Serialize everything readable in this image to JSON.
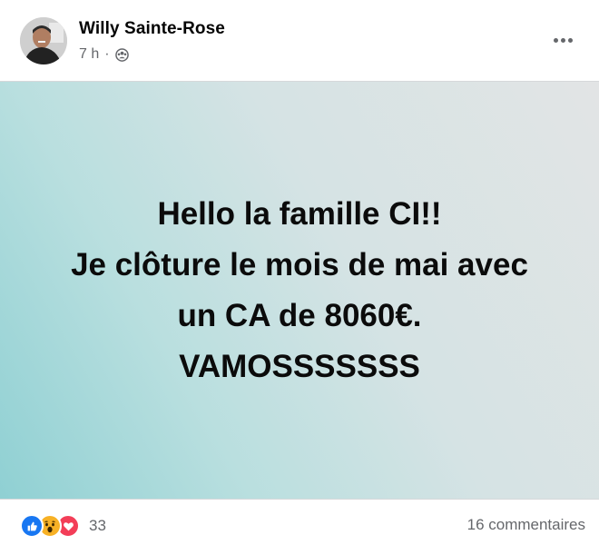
{
  "post": {
    "author": "Willy Sainte-Rose",
    "time": "7 h",
    "separator": "·",
    "audience_icon": "group-audience-icon",
    "lines": [
      "Hello la famille CI!!",
      "Je clôture le mois de mai avec",
      "un CA de 8060€.",
      "VAMOSSSSSSS"
    ]
  },
  "footer": {
    "reactions": [
      "like-reaction-icon",
      "wow-reaction-icon",
      "love-reaction-icon"
    ],
    "reaction_count": "33",
    "comments": "16 commentaires"
  },
  "colors": {
    "like": "#1877f2",
    "wow": "#f7b125",
    "love": "#f33e58",
    "secondary_text": "#65676b"
  }
}
